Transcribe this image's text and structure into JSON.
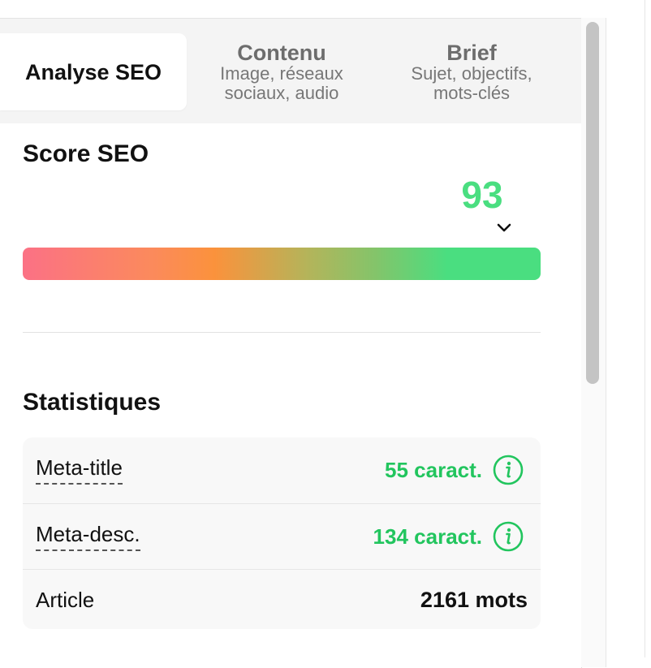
{
  "tabs": [
    {
      "title": "Analyse SEO",
      "subtitle": ""
    },
    {
      "title": "Contenu",
      "subtitle_line1": "Image, réseaux",
      "subtitle_line2": "sociaux, audio"
    },
    {
      "title": "Brief",
      "subtitle_line1": "Sujet, objectifs,",
      "subtitle_line2": "mots-clés"
    }
  ],
  "score": {
    "title": "Score SEO",
    "value": "93",
    "value_fraction": 0.93,
    "value_color": "#4ade80"
  },
  "stats": {
    "title": "Statistiques",
    "rows": [
      {
        "label": "Meta-title",
        "value": "55 caract.",
        "has_info": true
      },
      {
        "label": "Meta-desc.",
        "value": "134 caract.",
        "has_info": true
      },
      {
        "label": "Article",
        "value": "2161 mots",
        "has_info": false
      }
    ]
  },
  "colors": {
    "accent_green": "#22c55e",
    "bar_start": "#fb7185",
    "bar_mid": "#fb923c",
    "bar_end": "#4ade80"
  },
  "icons": {
    "dropdown": "chevron-down-icon",
    "info": "info-icon"
  }
}
